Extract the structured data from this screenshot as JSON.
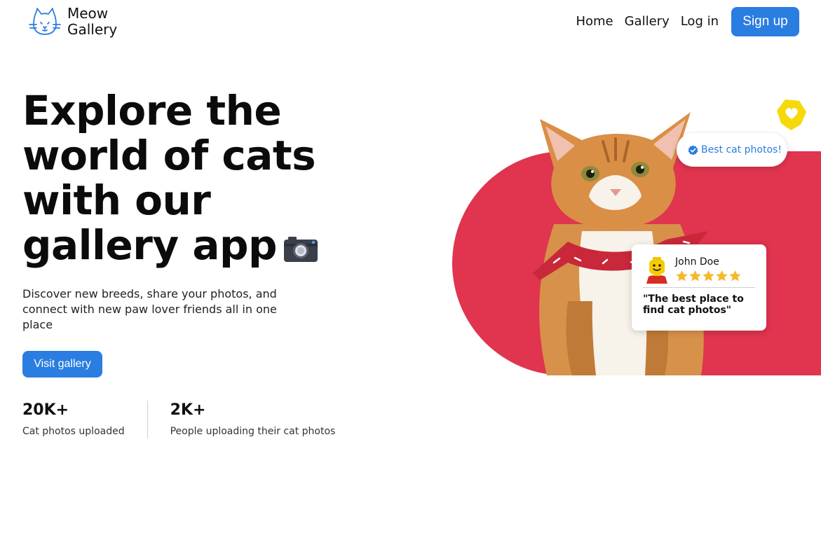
{
  "header": {
    "brand_line1": "Meow",
    "brand_line2": "Gallery",
    "nav": [
      "Home",
      "Gallery",
      "Log in"
    ],
    "signup_label": "Sign up"
  },
  "hero": {
    "title": "Explore the world of cats with our gallery app",
    "subtitle": "Discover new breeds, share your photos, and connect with new paw lover friends all in one place",
    "cta_label": "Visit gallery"
  },
  "stats": [
    {
      "value": "20K+",
      "label": "Cat photos uploaded"
    },
    {
      "value": "2K+",
      "label": "People uploading their cat photos"
    }
  ],
  "visual": {
    "badge_text": "Best cat photos!",
    "review": {
      "name": "John Doe",
      "rating": 5,
      "quote": "\"The best place to find cat photos\""
    }
  },
  "colors": {
    "accent": "#2a7de1",
    "red": "#e0344f",
    "yellow": "#f5d90a",
    "star": "#f6b82b"
  },
  "icons": [
    "cat-logo-icon",
    "camera-icon",
    "heart-icon",
    "verified-check-icon",
    "star-icon",
    "lego-avatar-icon"
  ]
}
